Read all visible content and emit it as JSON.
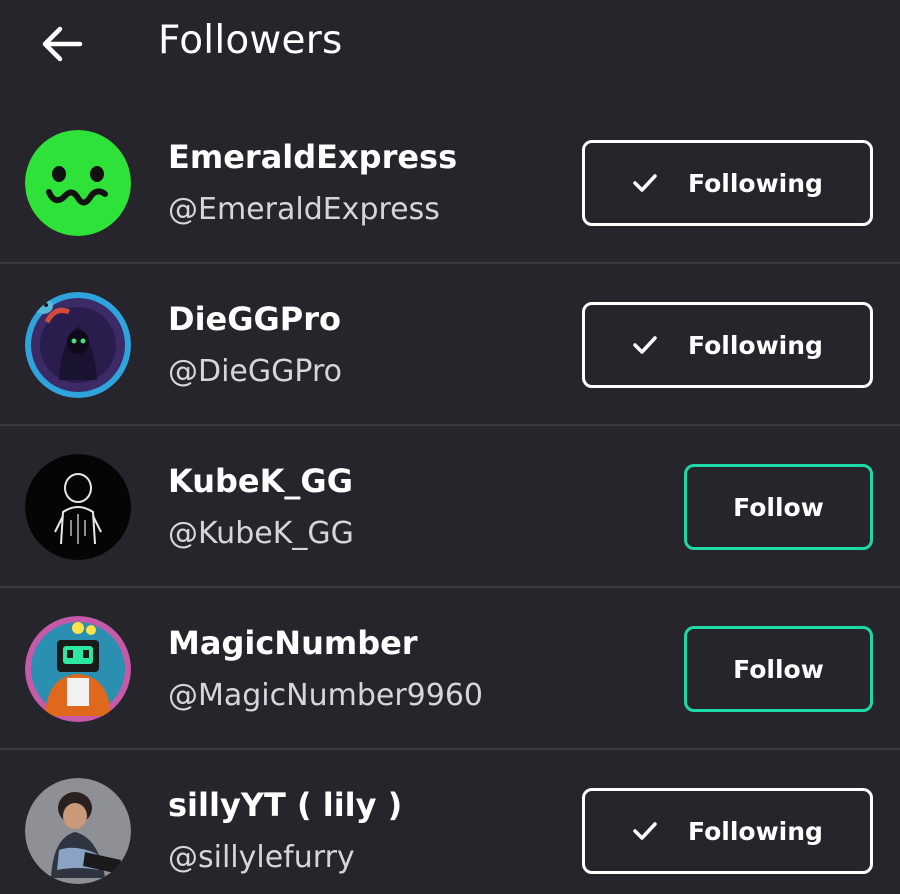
{
  "header": {
    "title": "Followers",
    "back_icon": "arrow-left-icon"
  },
  "colors": {
    "background": "#26252c",
    "divider": "#3a3940",
    "follow_accent": "#1fd8a8",
    "following_border": "#ffffff"
  },
  "followers": [
    {
      "name": "EmeraldExpress",
      "handle": "@EmeraldExpress",
      "button": "Following",
      "is_following": true
    },
    {
      "name": "DieGGPro",
      "handle": "@DieGGPro",
      "button": "Following",
      "is_following": true
    },
    {
      "name": "KubeK_GG",
      "handle": "@KubeK_GG",
      "button": "Follow",
      "is_following": false
    },
    {
      "name": "MagicNumber",
      "handle": "@MagicNumber9960",
      "button": "Follow",
      "is_following": false
    },
    {
      "name": "sillyYT ( lily )",
      "handle": "@sillylefurry",
      "button": "Following",
      "is_following": true
    }
  ]
}
